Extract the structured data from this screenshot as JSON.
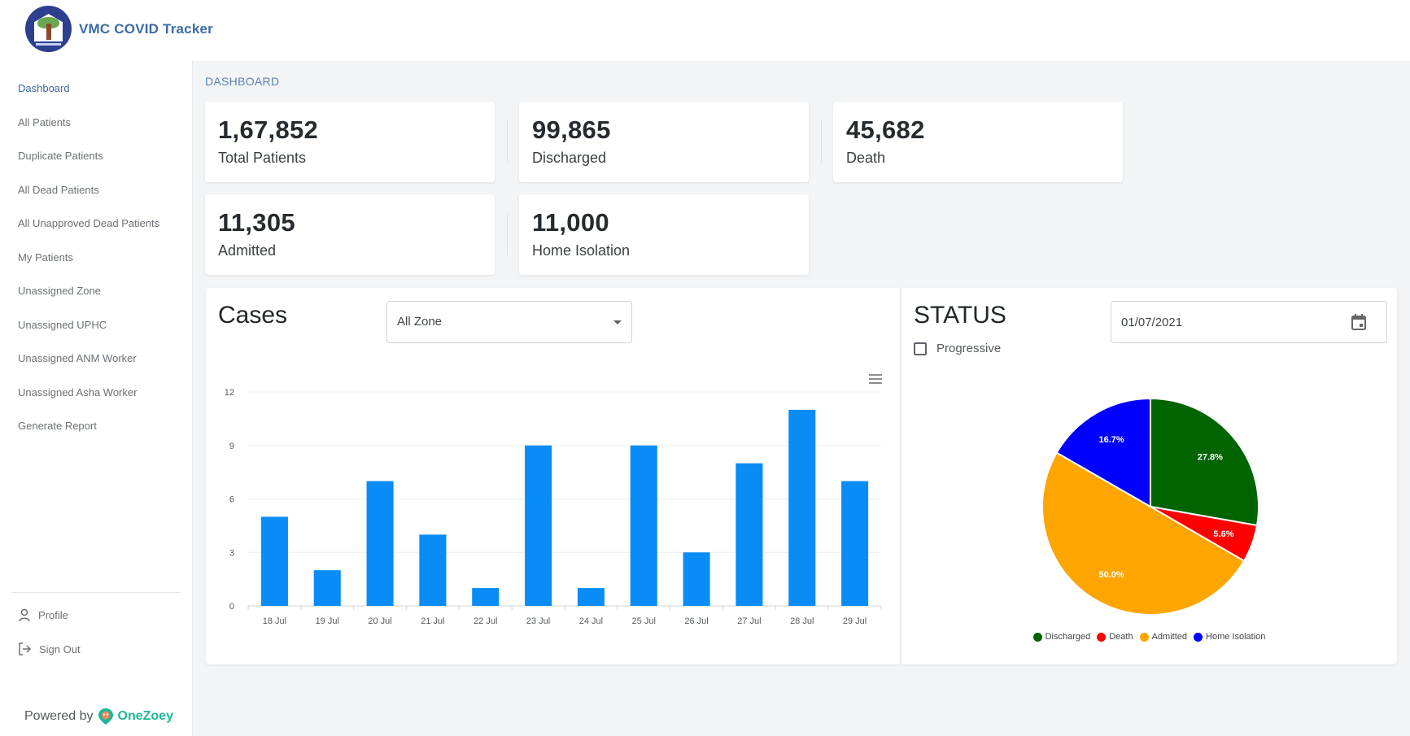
{
  "app": {
    "title": "VMC COVID Tracker",
    "logo": "vmc-logo"
  },
  "sidebar": {
    "items": [
      {
        "label": "Dashboard",
        "active": true
      },
      {
        "label": "All Patients"
      },
      {
        "label": "Duplicate Patients"
      },
      {
        "label": "All Dead Patients"
      },
      {
        "label": "All Unapproved Dead Patients"
      },
      {
        "label": "My Patients"
      },
      {
        "label": "Unassigned Zone"
      },
      {
        "label": "Unassigned UPHC"
      },
      {
        "label": "Unassigned ANM Worker"
      },
      {
        "label": "Unassigned Asha Worker"
      },
      {
        "label": "Generate Report"
      }
    ],
    "profile": {
      "label": "Profile",
      "icon": "user-icon"
    },
    "signout": {
      "label": "Sign Out",
      "icon": "sign-out-icon"
    },
    "powered_by": {
      "prefix": "Powered by",
      "brand": "OneZoey",
      "brand_color": "#1db89a"
    }
  },
  "breadcrumb": "DASHBOARD",
  "stats": [
    {
      "value": "1,67,852",
      "label": "Total Patients"
    },
    {
      "value": "99,865",
      "label": "Discharged"
    },
    {
      "value": "45,682",
      "label": "Death"
    },
    {
      "value": "11,305",
      "label": "Admitted"
    },
    {
      "value": "11,000",
      "label": "Home Isolation"
    }
  ],
  "cases": {
    "title": "Cases",
    "zone_select": {
      "value": "All Zone"
    },
    "menu_icon": "hamburger-menu-icon"
  },
  "status": {
    "title": "STATUS",
    "date": "01/07/2021",
    "progressive": {
      "label": "Progressive",
      "checked": false
    }
  },
  "chart_data": [
    {
      "type": "bar",
      "title": "Cases",
      "categories": [
        "18 Jul",
        "19 Jul",
        "20 Jul",
        "21 Jul",
        "22 Jul",
        "23 Jul",
        "24 Jul",
        "25 Jul",
        "26 Jul",
        "27 Jul",
        "28 Jul",
        "29 Jul"
      ],
      "values": [
        5,
        2,
        7,
        4,
        1,
        9,
        1,
        9,
        3,
        8,
        11,
        7
      ],
      "yticks": [
        0,
        3,
        6,
        9,
        12
      ],
      "ylim": [
        0,
        12
      ],
      "xlabel": "",
      "ylabel": "",
      "grid": true,
      "color": "#0a8cf7"
    },
    {
      "type": "pie",
      "title": "STATUS",
      "slices": [
        {
          "name": "Discharged",
          "percent": 27.8,
          "label": "27.8%",
          "color": "#006400"
        },
        {
          "name": "Death",
          "percent": 5.6,
          "label": "5.6%",
          "color": "#ff0000"
        },
        {
          "name": "Admitted",
          "percent": 50.0,
          "label": "50.0%",
          "color": "#ffa500"
        },
        {
          "name": "Home Isolation",
          "percent": 16.7,
          "label": "16.7%",
          "color": "#0000ff"
        }
      ],
      "legend": "bottom"
    }
  ]
}
